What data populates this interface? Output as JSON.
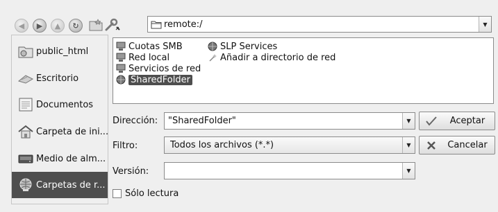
{
  "toolbar": {
    "back_icon": "back-icon",
    "forward_icon": "forward-icon",
    "up_icon": "up-icon",
    "reload_icon": "reload-icon",
    "new_folder_icon": "new-folder-icon",
    "settings_icon": "settings-icon",
    "path": "remote:/"
  },
  "sidebar": {
    "items": [
      {
        "label": "public_html",
        "icon": "folder-icon"
      },
      {
        "label": "Escritorio",
        "icon": "desktop-icon"
      },
      {
        "label": "Documentos",
        "icon": "documents-icon"
      },
      {
        "label": "Carpeta de ini...",
        "icon": "home-icon"
      },
      {
        "label": "Medio de alm...",
        "icon": "drive-icon"
      },
      {
        "label": "Carpetas de r...",
        "icon": "network-icon"
      }
    ],
    "selected_index": 5
  },
  "files": [
    {
      "label": "Cuotas SMB",
      "icon": "smb-icon"
    },
    {
      "label": "Red local",
      "icon": "network-icon"
    },
    {
      "label": "Servicios de red",
      "icon": "network-services-icon"
    },
    {
      "label": "SharedFolder",
      "icon": "globe-icon"
    },
    {
      "label": "SLP Services",
      "icon": "globe-icon"
    },
    {
      "label": "Añadir a directorio de red",
      "icon": "wand-icon"
    }
  ],
  "form": {
    "location_label": "Dirección:",
    "location_value": "\"SharedFolder\"",
    "filter_label": "Filtro:",
    "filter_value": "Todos los archivos (*.*)",
    "version_label": "Versión:",
    "version_value": "",
    "readonly_label": "Sólo lectura",
    "readonly_checked": false
  },
  "buttons": {
    "accept_label": "Aceptar",
    "cancel_label": "Cancelar"
  },
  "colors": {
    "background": "#efefef",
    "selection": "#4e4e4e",
    "field": "#ffffff",
    "border": "#8a8a8a"
  }
}
